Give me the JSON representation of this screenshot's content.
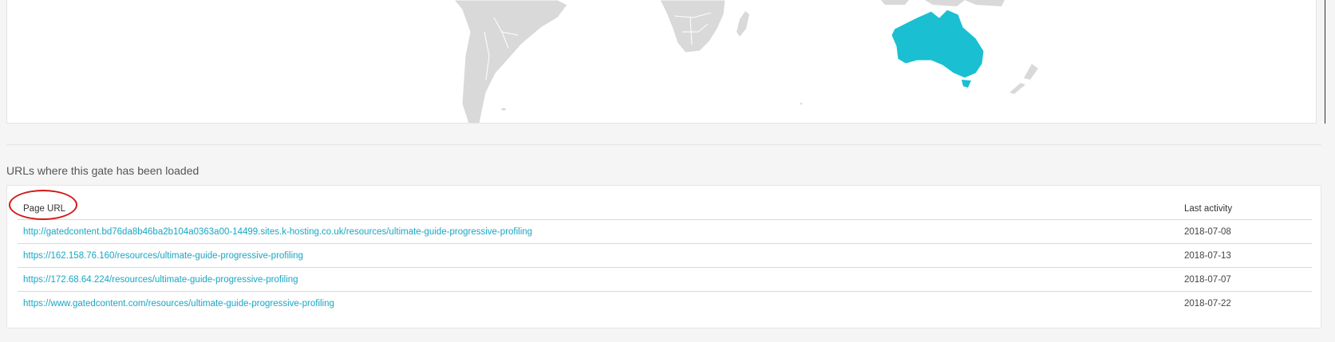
{
  "map": {
    "highlight_color": "#1abfd2",
    "land_color": "#d9d9d9",
    "highlighted_region": "Australia"
  },
  "section": {
    "title": "URLs where this gate has been loaded"
  },
  "table": {
    "columns": {
      "url": "Page URL",
      "activity": "Last activity"
    },
    "link_color": "#17a7c4",
    "rows": [
      {
        "url": "http://gatedcontent.bd76da8b46ba2b104a0363a00-14499.sites.k-hosting.co.uk/resources/ultimate-guide-progressive-profiling",
        "date": "2018-07-08"
      },
      {
        "url": "https://162.158.76.160/resources/ultimate-guide-progressive-profiling",
        "date": "2018-07-13"
      },
      {
        "url": "https://172.68.64.224/resources/ultimate-guide-progressive-profiling",
        "date": "2018-07-07"
      },
      {
        "url": "https://www.gatedcontent.com/resources/ultimate-guide-progressive-profiling",
        "date": "2018-07-22"
      }
    ]
  },
  "annotation": {
    "color": "#d11a1a",
    "target": "Page URL"
  }
}
